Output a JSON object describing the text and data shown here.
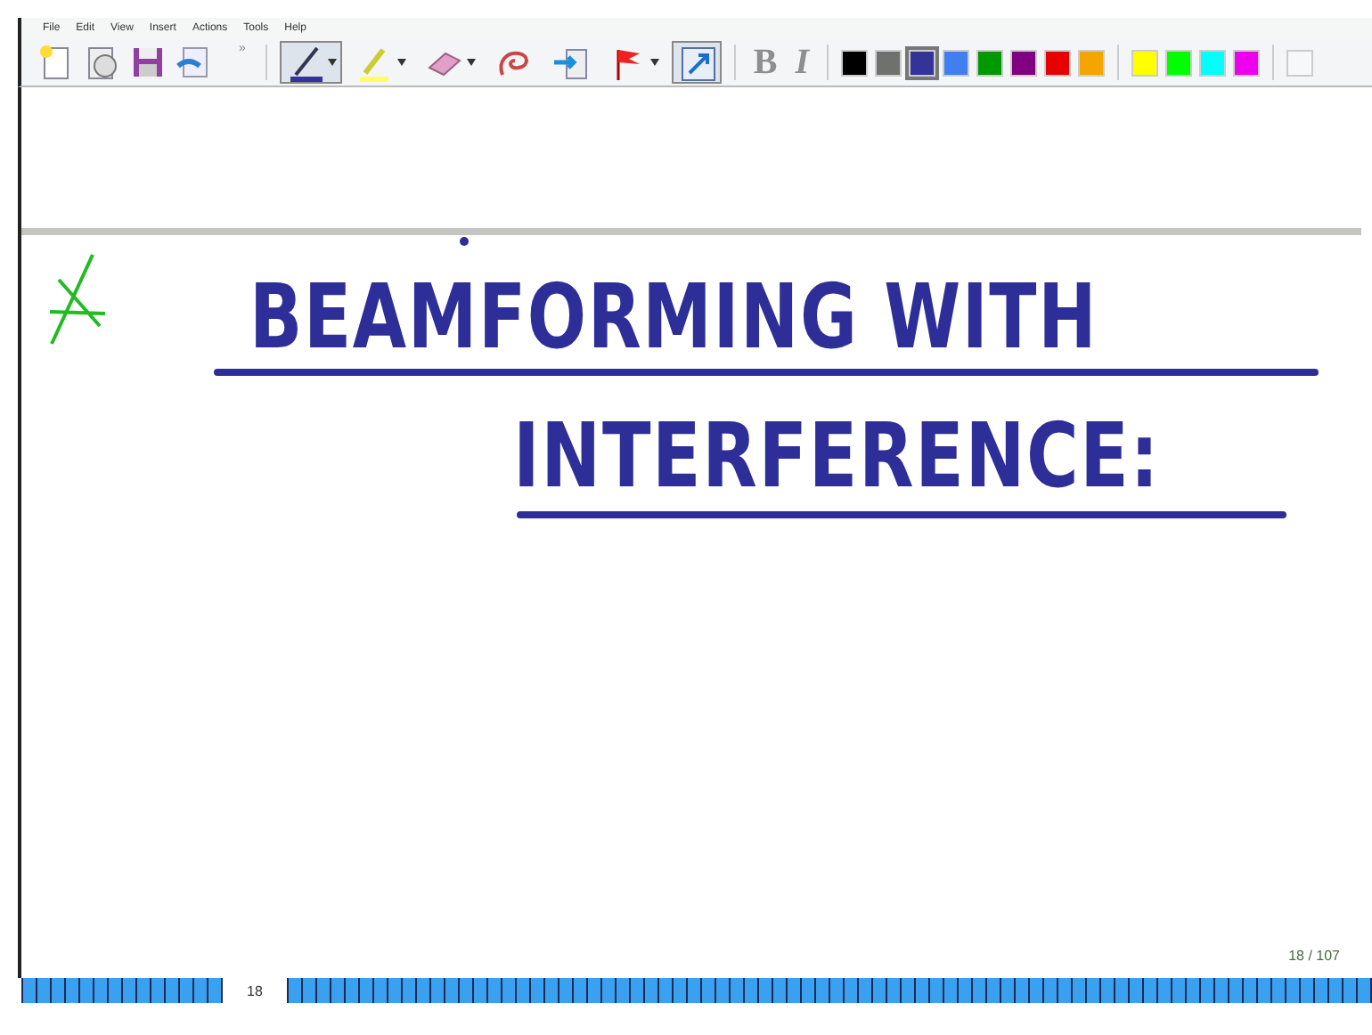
{
  "menu": [
    "File",
    "Edit",
    "View",
    "Insert",
    "Actions",
    "Tools",
    "Help"
  ],
  "toolbar": {
    "overflow": "»",
    "tools": [
      {
        "kind": "pen",
        "selected": true
      },
      {
        "kind": "highlighter",
        "selected": false
      },
      {
        "kind": "eraser",
        "selected": false
      },
      {
        "kind": "lasso",
        "selected": false
      },
      {
        "kind": "insert",
        "selected": false
      },
      {
        "kind": "flag",
        "selected": false
      },
      {
        "kind": "select",
        "selected": true
      }
    ],
    "bold": "B",
    "italic": "I"
  },
  "colors": [
    {
      "color": "#000000",
      "selected": false
    },
    {
      "color": "#6e716e",
      "selected": false
    },
    {
      "color": "#333399",
      "selected": true
    },
    {
      "color": "#3f7ff0",
      "selected": false
    },
    {
      "color": "#009a00",
      "selected": false
    },
    {
      "color": "#800080",
      "selected": false
    },
    {
      "color": "#e60000",
      "selected": false
    },
    {
      "color": "#f5a500",
      "selected": false
    },
    {
      "color": "#ffff00",
      "selected": false
    },
    {
      "color": "#00ff00",
      "selected": false
    },
    {
      "color": "#00ffff",
      "selected": false
    },
    {
      "color": "#ee00ee",
      "selected": false
    },
    {
      "color": "#f6f8fa",
      "selected": false
    }
  ],
  "page": {
    "heading_lines": [
      "BEAMFORMING WITH",
      "INTERFERENCE:"
    ],
    "page_indicator": "18 / 107"
  },
  "page_strip": {
    "current": "18"
  }
}
